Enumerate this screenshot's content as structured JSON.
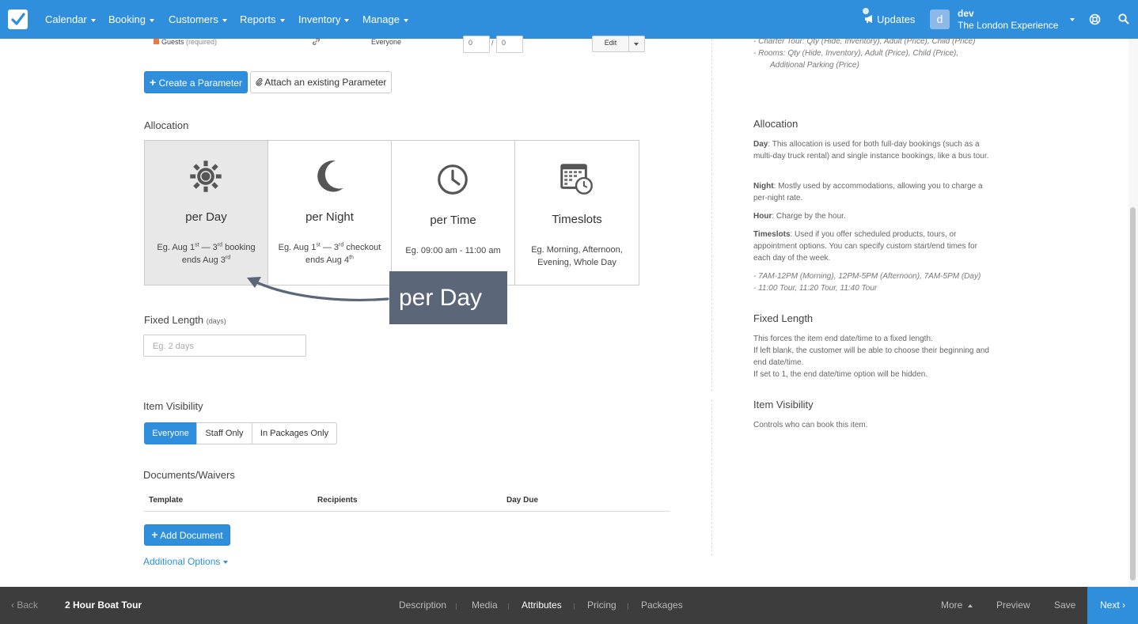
{
  "nav": {
    "items": [
      "Calendar",
      "Booking",
      "Customers",
      "Reports",
      "Inventory",
      "Manage"
    ],
    "updates": "Updates",
    "avatar_letter": "d",
    "user_name": "dev",
    "user_org": "The London Experience"
  },
  "guests_row": {
    "label": "Guests",
    "req": "(required)",
    "visibility": "Everyone",
    "min": "0",
    "sep": "/",
    "max": "0",
    "edit": "Edit"
  },
  "buttons": {
    "create_param": "Create a Parameter",
    "attach_param": "Attach an existing Parameter",
    "add_document": "Add Document"
  },
  "allocation": {
    "heading": "Allocation",
    "options": [
      {
        "title": "per Day",
        "desc_a": "Eg. Aug 1",
        "sup_a": "st",
        "desc_b": " — 3",
        "sup_b": "rd",
        "desc_c": " booking ends Aug 3",
        "sup_c": "rd"
      },
      {
        "title": "per Night",
        "desc_a": "Eg. Aug 1",
        "sup_a": "st",
        "desc_b": " — 3",
        "sup_b": "rd",
        "desc_c": " checkout ends Aug 4",
        "sup_c": "th"
      },
      {
        "title": "per Time",
        "desc": "Eg. 09:00 am - 11:00 am"
      },
      {
        "title": "Timeslots",
        "desc": "Eg. Morning, Afternoon, Evening, Whole Day"
      }
    ],
    "callout": "per Day"
  },
  "fixed_length": {
    "heading": "Fixed Length",
    "unit": "(days)",
    "placeholder": "Eg. 2 days"
  },
  "visibility": {
    "heading": "Item Visibility",
    "options": [
      "Everyone",
      "Staff Only",
      "In Packages Only"
    ]
  },
  "documents": {
    "heading": "Documents/Waivers",
    "columns": [
      "Template",
      "Recipients",
      "Day Due"
    ]
  },
  "additional_options": "Additional Options",
  "help": {
    "top_lines": [
      "- Charter Tour: Qty (Hide, Inventory), Adult (Price), Child (Price)",
      "- Rooms: Qty (Hide, Inventory), Adult (Price), Child (Price),",
      "Additional Parking (Price)"
    ],
    "allocation_h": "Allocation",
    "day_b": "Day",
    "day_t": ": This allocation is used for both full-day bookings (such as a multi-day truck rental) and single instance bookings, like a bus tour.",
    "night_b": "Night",
    "night_t": ": Mostly used by accommodations, allowing you to charge a per-night rate.",
    "hour_b": "Hour",
    "hour_t": ": Charge by the hour.",
    "ts_b": "Timeslots",
    "ts_t": ": Used if you offer scheduled products, tours, or appointment options. You can specify custom start/end times for each day of the week.",
    "ts_ex1": "- 7AM-12PM (Morning), 12PM-5PM (Afternoon), 7AM-5PM (Day)",
    "ts_ex2": "- 11:00 Tour, 11:20 Tour, 11:40 Tour",
    "fixed_h": "Fixed Length",
    "fixed_1": "This forces the item end date/time to a fixed length.",
    "fixed_2": "If left blank, the customer will be able to choose their beginning and end date/time.",
    "fixed_3": "If set to 1, the end date/time option will be hidden.",
    "vis_h": "Item Visibility",
    "vis_t": "Controls who can book this item."
  },
  "bottom": {
    "back": "Back",
    "product": "2 Hour Boat Tour",
    "tabs": [
      "Description",
      "Media",
      "Attributes",
      "Pricing",
      "Packages"
    ],
    "active_tab": "Attributes",
    "more": "More",
    "preview": "Preview",
    "save": "Save",
    "next": "Next"
  }
}
